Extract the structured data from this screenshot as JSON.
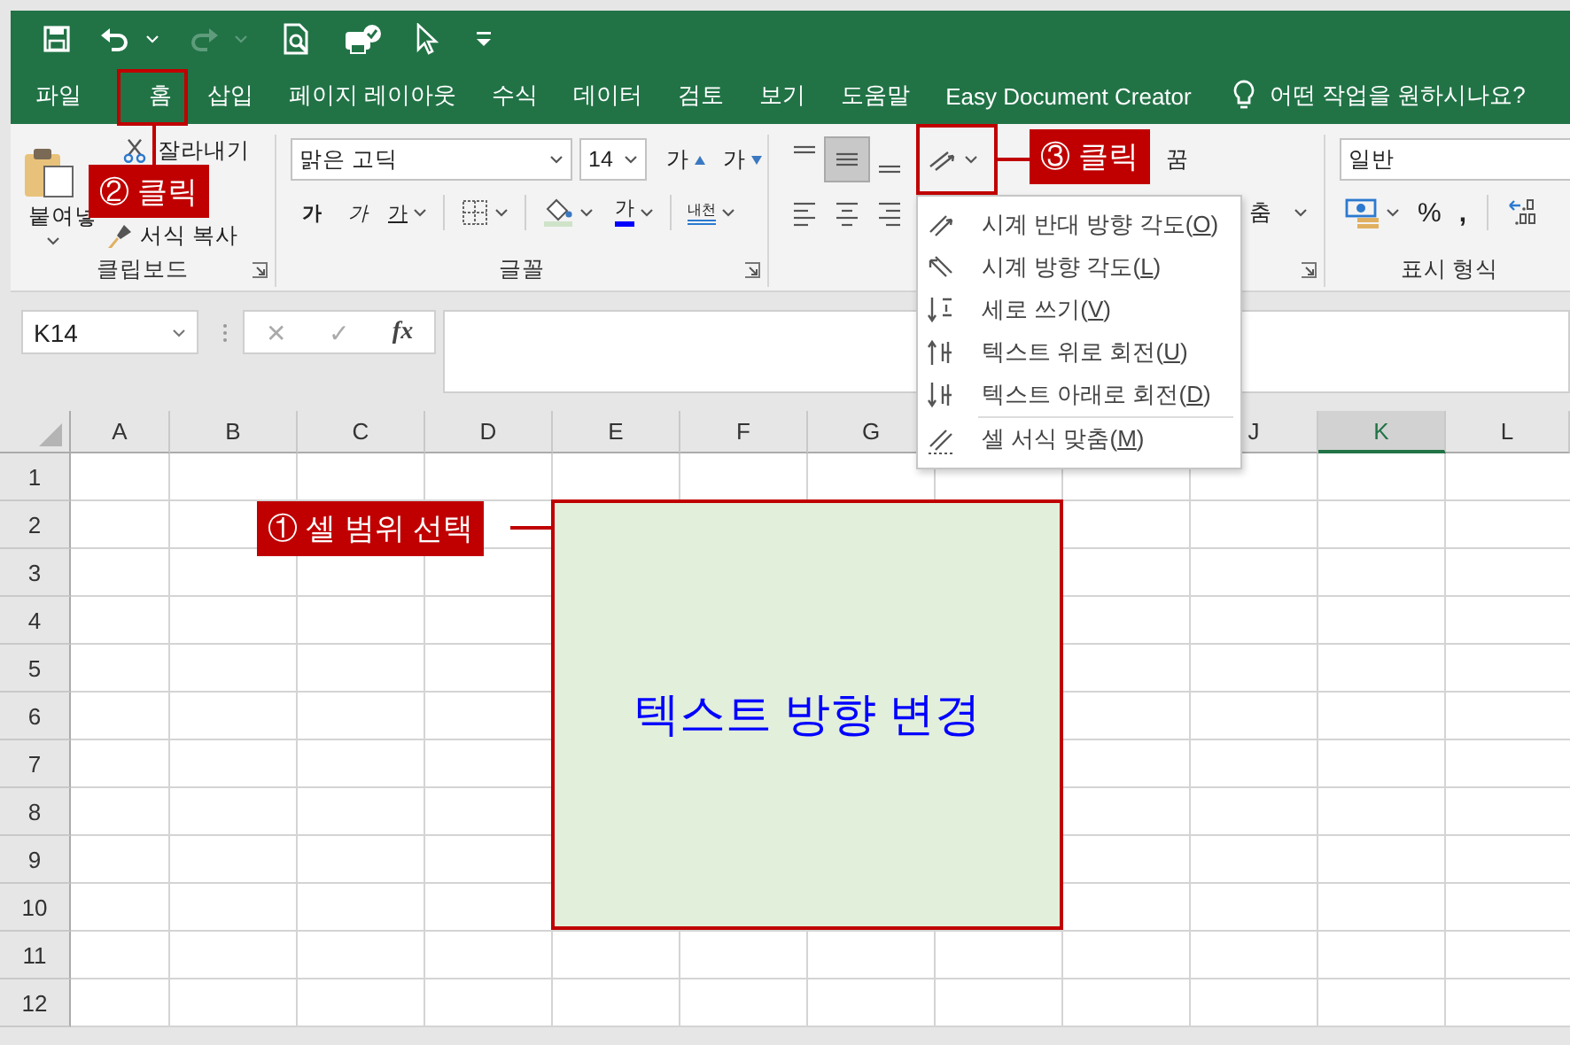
{
  "tabs": [
    {
      "label": "파일"
    },
    {
      "label": "홈"
    },
    {
      "label": "삽입"
    },
    {
      "label": "페이지 레이아웃"
    },
    {
      "label": "수식"
    },
    {
      "label": "데이터"
    },
    {
      "label": "검토"
    },
    {
      "label": "보기"
    },
    {
      "label": "도움말"
    },
    {
      "label": "Easy Document Creator"
    }
  ],
  "tell_me": {
    "label": "어떤 작업을 원하시나요?"
  },
  "ribbon": {
    "clipboard": {
      "paste": "붙여넣",
      "cut": "잘라내기",
      "format_painter": "서식 복사",
      "group_label": "클립보드"
    },
    "font": {
      "font_name": "맑은 고딕",
      "font_size": "14",
      "grow": "가",
      "shrink": "가",
      "bold": "가",
      "italic": "가",
      "underline": "가",
      "font_color": "가",
      "phonetic": "내천",
      "group_label": "글꼴"
    },
    "alignment": {
      "vertical": [
        {
          "pressed": false
        },
        {
          "pressed": true
        },
        {
          "pressed": false
        }
      ],
      "wrap_text": "꿈",
      "merge": "춤"
    },
    "number": {
      "format": "일반",
      "percent": "%",
      "comma": ",",
      "group_label": "표시 형식"
    }
  },
  "formula_bar": {
    "name_box": "K14",
    "cancel": "✕",
    "enter": "✓",
    "function": "fx"
  },
  "sheet": {
    "columns": [
      {
        "label": "A",
        "selected": false
      },
      {
        "label": "B",
        "selected": false
      },
      {
        "label": "C",
        "selected": false
      },
      {
        "label": "D",
        "selected": false
      },
      {
        "label": "E",
        "selected": false
      },
      {
        "label": "F",
        "selected": false
      },
      {
        "label": "G",
        "selected": false
      },
      {
        "label": "J",
        "selected": false
      },
      {
        "label": "K",
        "selected": true
      },
      {
        "label": "L",
        "selected": false
      }
    ],
    "rows": [
      "1",
      "2",
      "3",
      "4",
      "5",
      "6",
      "7",
      "8",
      "9",
      "10",
      "11",
      "12"
    ],
    "selection_text": "텍스트 방향 변경"
  },
  "menu": {
    "items": [
      {
        "kind": "ccw",
        "label": "시계 반대 방향 각도(O)",
        "separator_before": false
      },
      {
        "kind": "cw",
        "label": "시계 방향 각도(L)",
        "separator_before": false
      },
      {
        "kind": "vertical",
        "label": "세로 쓰기(V)",
        "separator_before": false
      },
      {
        "kind": "up",
        "label": "텍스트 위로 회전(U)",
        "separator_before": false
      },
      {
        "kind": "down",
        "label": "텍스트 아래로 회전(D)",
        "separator_before": false
      },
      {
        "kind": "format",
        "label": "셀 서식 맞춤(M)",
        "separator_before": true
      }
    ]
  },
  "callouts": [
    {
      "label": "① 셀 범위 선택"
    },
    {
      "label": "② 클릭"
    },
    {
      "label": "③ 클릭"
    }
  ]
}
